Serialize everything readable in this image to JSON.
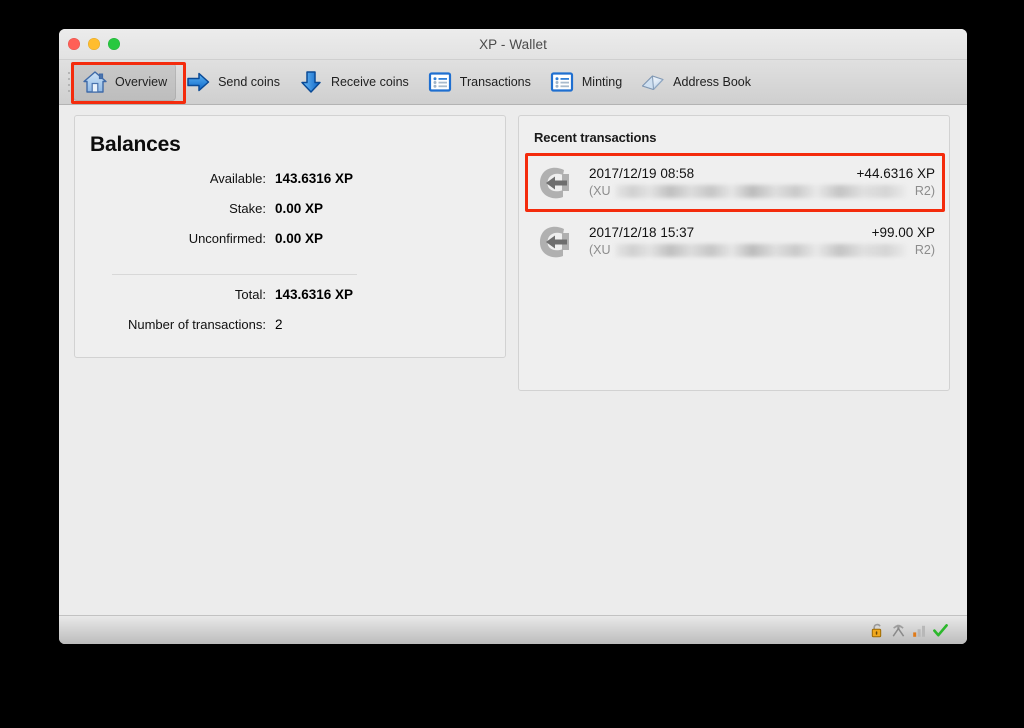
{
  "window": {
    "title": "XP - Wallet",
    "traffic_lights": [
      {
        "name": "close",
        "color": "#ff5f57"
      },
      {
        "name": "minimize",
        "color": "#ffbd2e"
      },
      {
        "name": "zoom",
        "color": "#28c840"
      }
    ]
  },
  "toolbar": {
    "items": [
      {
        "label": "Overview",
        "icon": "home-icon",
        "active": true
      },
      {
        "label": "Send coins",
        "icon": "arrow-right-icon",
        "active": false
      },
      {
        "label": "Receive coins",
        "icon": "arrow-down-icon",
        "active": false
      },
      {
        "label": "Transactions",
        "icon": "list-icon",
        "active": false
      },
      {
        "label": "Minting",
        "icon": "list-icon",
        "active": false
      },
      {
        "label": "Address Book",
        "icon": "book-icon",
        "active": false
      }
    ]
  },
  "balances": {
    "title": "Balances",
    "rows": [
      {
        "label": "Available:",
        "value": "143.6316 XP"
      },
      {
        "label": "Stake:",
        "value": "0.00 XP"
      },
      {
        "label": "Unconfirmed:",
        "value": "0.00 XP"
      }
    ],
    "totals": [
      {
        "label": "Total:",
        "value": "143.6316 XP"
      }
    ],
    "count_label": "Number of transactions:",
    "count_value": "2"
  },
  "recent": {
    "title": "Recent transactions",
    "transactions": [
      {
        "icon": "receive-coin-icon",
        "date": "2017/12/19 08:58",
        "amount": "+44.6316 XP",
        "address_prefix": "(XU",
        "address_suffix": "R2)",
        "highlighted": true
      },
      {
        "icon": "receive-coin-icon",
        "date": "2017/12/18 15:37",
        "amount": "+99.00 XP",
        "address_prefix": "(XU",
        "address_suffix": "R2)",
        "highlighted": false
      }
    ]
  },
  "statusbar": {
    "icons": [
      {
        "name": "lock-unlocked-icon"
      },
      {
        "name": "mining-hammers-icon"
      },
      {
        "name": "signal-bars-icon"
      },
      {
        "name": "sync-check-icon"
      }
    ]
  },
  "annotations": {
    "accent_color": "#f42b0c"
  }
}
